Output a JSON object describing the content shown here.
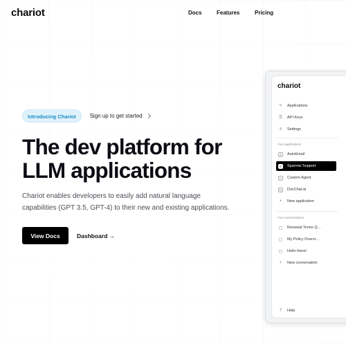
{
  "header": {
    "logo": "chariot",
    "nav": [
      "Docs",
      "Features",
      "Pricing"
    ]
  },
  "hero": {
    "badge": "Introducing Chariot",
    "signup": "Sign up to get started",
    "title_line1": "The dev platform for",
    "title_line2": "LLM applications",
    "subtitle_line1": "Chariot enables developers to easily add natural language",
    "subtitle_line2": "capabilities (GPT 3.5, GPT-4) to their new and existing applications.",
    "primary_cta": "View Docs",
    "secondary_cta": "Dashboard →"
  },
  "app": {
    "logo": "chariot",
    "nav": [
      {
        "label": "Applications",
        "icon": "bolt-icon"
      },
      {
        "label": "API Keys",
        "icon": "key-icon"
      },
      {
        "label": "Settings",
        "icon": "sliders-icon"
      }
    ],
    "apps_label": "Your applications",
    "applications": [
      {
        "label": "AutoEmail",
        "letter": "A"
      },
      {
        "label": "Sparrow Support",
        "letter": "S"
      },
      {
        "label": "Custom Agent",
        "letter": "C"
      },
      {
        "label": "DocChat.ai",
        "letter": "D"
      }
    ],
    "new_application": "New application",
    "conversations_label": "Your conversations",
    "conversations": [
      "Renewal Terms Q...",
      "My Policy Overvi...",
      "Hello there!"
    ],
    "new_conversation": "New conversation",
    "help": "Help",
    "active_application": "Sparrow Support"
  },
  "colors": {
    "accent_pill_bg": "#dff2fb",
    "accent_pill_text": "#1b8cc6",
    "primary_button": "#000000"
  }
}
